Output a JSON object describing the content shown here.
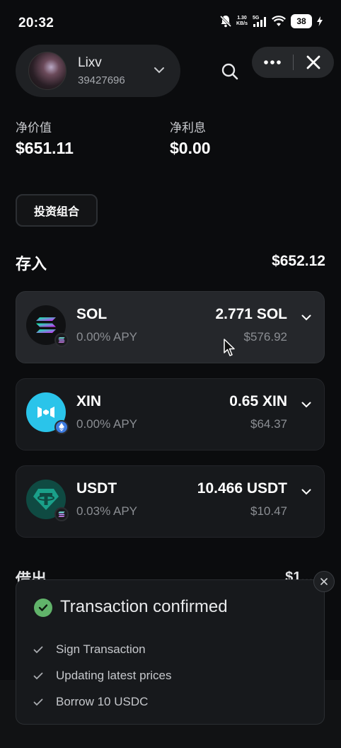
{
  "status_bar": {
    "time": "20:32",
    "net_speed_top": "1.30",
    "net_speed_bottom": "KB/s",
    "network": "5G",
    "battery": "38"
  },
  "header": {
    "account_name": "Lixv",
    "account_id": "39427696"
  },
  "summary": {
    "net_value_label": "净价值",
    "net_value": "$651.11",
    "net_interest_label": "净利息",
    "net_interest": "$0.00"
  },
  "portfolio_button": "投资组合",
  "deposit": {
    "title": "存入",
    "total": "$652.12",
    "assets": [
      {
        "symbol": "SOL",
        "apy": "0.00% APY",
        "amount": "2.771 SOL",
        "usd": "$576.92",
        "icon": "solana-icon",
        "chain": "solana-chain-icon"
      },
      {
        "symbol": "XIN",
        "apy": "0.00% APY",
        "amount": "0.65 XIN",
        "usd": "$64.37",
        "icon": "mixin-icon",
        "chain": "ethereum-chain-icon"
      },
      {
        "symbol": "USDT",
        "apy": "0.03% APY",
        "amount": "10.466 USDT",
        "usd": "$10.47",
        "icon": "tether-icon",
        "chain": "solana-chain-icon"
      }
    ]
  },
  "borrow": {
    "title": "借出",
    "total": "$1..."
  },
  "toast": {
    "title": "Transaction confirmed",
    "steps": [
      "Sign Transaction",
      "Updating latest prices",
      "Borrow 10 USDC"
    ]
  },
  "colors": {
    "background": "#0b0c0e",
    "card": "#17191c",
    "success": "#61b36a",
    "xin_bg": "#2ac4ea",
    "usdt_bg": "#0f4a42",
    "muted_text": "#8b8e93"
  }
}
